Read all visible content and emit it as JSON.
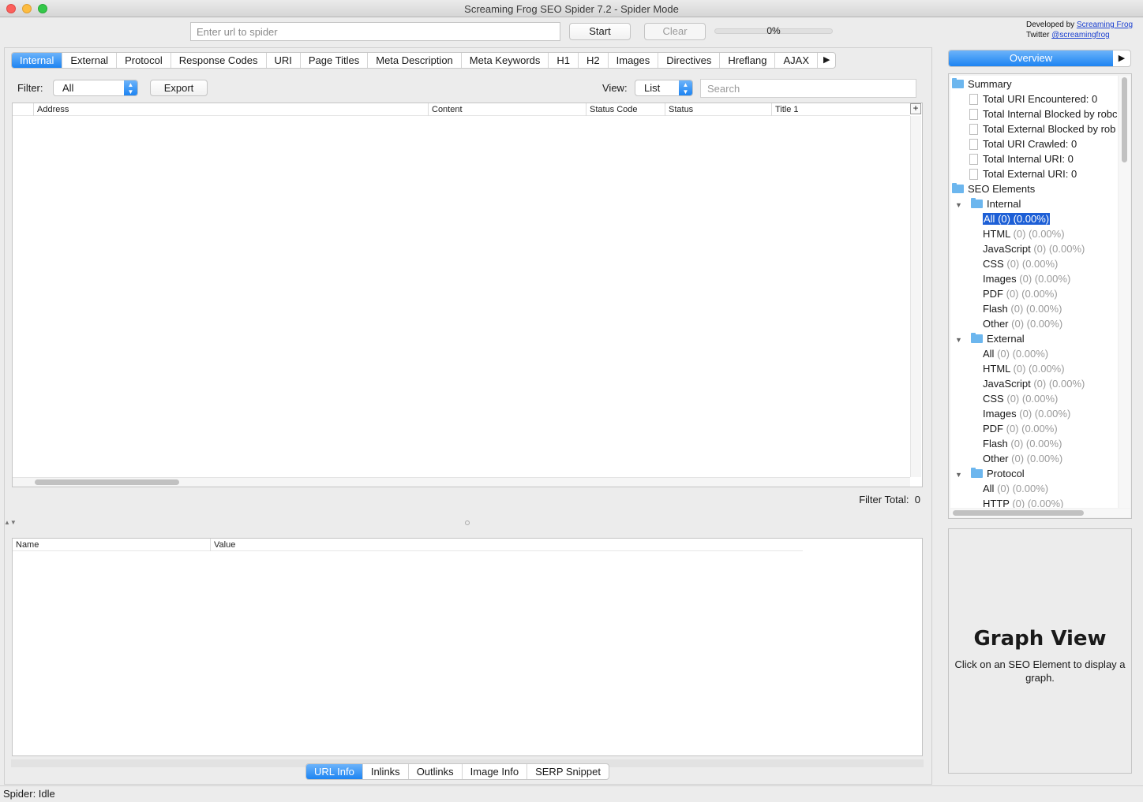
{
  "window": {
    "title": "Screaming Frog SEO Spider 7.2 - Spider Mode"
  },
  "toolbar": {
    "url_placeholder": "Enter url to spider",
    "start_label": "Start",
    "clear_label": "Clear",
    "progress_percent": 0,
    "progress_text": "0%",
    "developed_by_prefix": "Developed by ",
    "developed_by_link": "Screaming Frog",
    "twitter_prefix": "Twitter ",
    "twitter_link": "@screamingfrog"
  },
  "tabs": [
    {
      "label": "Internal",
      "active": true
    },
    {
      "label": "External"
    },
    {
      "label": "Protocol"
    },
    {
      "label": "Response Codes"
    },
    {
      "label": "URI"
    },
    {
      "label": "Page Titles"
    },
    {
      "label": "Meta Description"
    },
    {
      "label": "Meta Keywords"
    },
    {
      "label": "H1"
    },
    {
      "label": "H2"
    },
    {
      "label": "Images"
    },
    {
      "label": "Directives"
    },
    {
      "label": "Hreflang"
    },
    {
      "label": "AJAX"
    }
  ],
  "tabs_overflow_arrow": "▶",
  "filter_bar": {
    "filter_label": "Filter:",
    "filter_value": "All",
    "export_label": "Export",
    "view_label": "View:",
    "view_value": "List",
    "search_placeholder": "Search"
  },
  "main_table": {
    "columns": [
      "Address",
      "Content",
      "Status Code",
      "Status",
      "Title 1"
    ],
    "rows": [],
    "add_column_symbol": "+",
    "filter_total_label": "Filter Total:",
    "filter_total_value": "0"
  },
  "detail_table": {
    "columns": [
      "Name",
      "Value"
    ],
    "rows": []
  },
  "bottom_tabs": [
    {
      "label": "URL Info",
      "active": true
    },
    {
      "label": "Inlinks"
    },
    {
      "label": "Outlinks"
    },
    {
      "label": "Image Info"
    },
    {
      "label": "SERP Snippet"
    }
  ],
  "status_bar": {
    "text": "Spider: Idle"
  },
  "overview": {
    "tab_label": "Overview",
    "arrow": "▶",
    "tree": [
      {
        "type": "folder",
        "level": 0,
        "label": "Summary"
      },
      {
        "type": "doc",
        "level": 1,
        "label": "Total URI Encountered: 0"
      },
      {
        "type": "doc",
        "level": 1,
        "label": "Total Internal Blocked by robc"
      },
      {
        "type": "doc",
        "level": 1,
        "label": "Total External Blocked by rob"
      },
      {
        "type": "doc",
        "level": 1,
        "label": "Total URI Crawled: 0"
      },
      {
        "type": "doc",
        "level": 1,
        "label": "Total Internal URI: 0"
      },
      {
        "type": "doc",
        "level": 1,
        "label": "Total External URI: 0"
      },
      {
        "type": "folder",
        "level": 0,
        "label": "SEO Elements"
      },
      {
        "type": "folder",
        "level": 1,
        "label": "Internal",
        "expanded": true
      },
      {
        "type": "item",
        "level": 2,
        "label": "All",
        "count": "(0) (0.00%)",
        "selected": true
      },
      {
        "type": "item",
        "level": 2,
        "label": "HTML",
        "count": "(0) (0.00%)"
      },
      {
        "type": "item",
        "level": 2,
        "label": "JavaScript",
        "count": "(0) (0.00%)"
      },
      {
        "type": "item",
        "level": 2,
        "label": "CSS",
        "count": "(0) (0.00%)"
      },
      {
        "type": "item",
        "level": 2,
        "label": "Images",
        "count": "(0) (0.00%)"
      },
      {
        "type": "item",
        "level": 2,
        "label": "PDF",
        "count": "(0) (0.00%)"
      },
      {
        "type": "item",
        "level": 2,
        "label": "Flash",
        "count": "(0) (0.00%)"
      },
      {
        "type": "item",
        "level": 2,
        "label": "Other",
        "count": "(0) (0.00%)"
      },
      {
        "type": "folder",
        "level": 1,
        "label": "External",
        "expanded": true
      },
      {
        "type": "item",
        "level": 2,
        "label": "All",
        "count": "(0) (0.00%)"
      },
      {
        "type": "item",
        "level": 2,
        "label": "HTML",
        "count": "(0) (0.00%)"
      },
      {
        "type": "item",
        "level": 2,
        "label": "JavaScript",
        "count": "(0) (0.00%)"
      },
      {
        "type": "item",
        "level": 2,
        "label": "CSS",
        "count": "(0) (0.00%)"
      },
      {
        "type": "item",
        "level": 2,
        "label": "Images",
        "count": "(0) (0.00%)"
      },
      {
        "type": "item",
        "level": 2,
        "label": "PDF",
        "count": "(0) (0.00%)"
      },
      {
        "type": "item",
        "level": 2,
        "label": "Flash",
        "count": "(0) (0.00%)"
      },
      {
        "type": "item",
        "level": 2,
        "label": "Other",
        "count": "(0) (0.00%)"
      },
      {
        "type": "folder",
        "level": 1,
        "label": "Protocol",
        "expanded": true
      },
      {
        "type": "item",
        "level": 2,
        "label": "All",
        "count": "(0) (0.00%)"
      },
      {
        "type": "item",
        "level": 2,
        "label": "HTTP",
        "count": "(0) (0.00%)"
      }
    ]
  },
  "graph_view": {
    "title": "Graph View",
    "description": "Click on an SEO Element to display a graph."
  },
  "colors": {
    "accent": "#1d84f2",
    "selection": "#1d5fd6",
    "folder": "#6cb6ee",
    "link": "#1a3fd0"
  }
}
